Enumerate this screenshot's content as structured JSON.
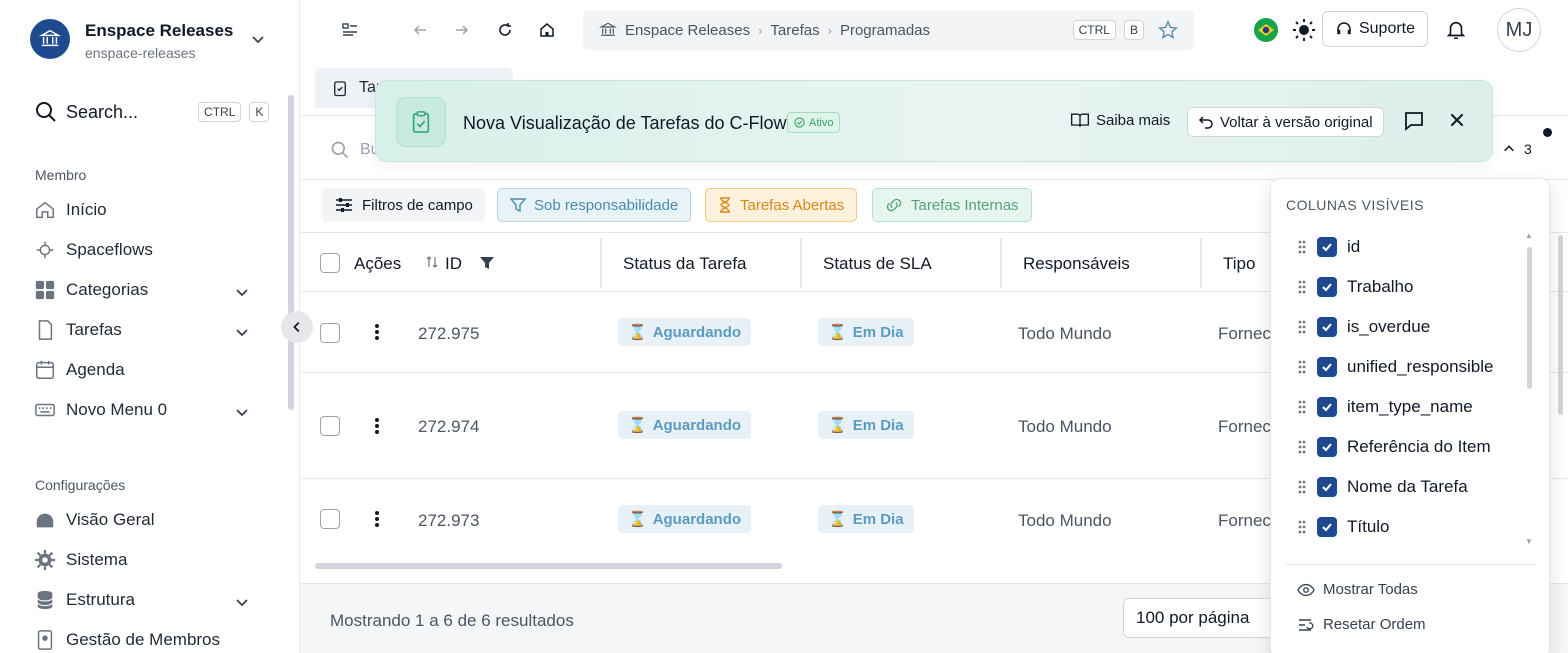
{
  "org": {
    "name": "Enspace Releases",
    "slug": "enspace-releases"
  },
  "search": {
    "label": "Search...",
    "kbd1": "CTRL",
    "kbd2": "K"
  },
  "sections": {
    "member": "Membro",
    "config": "Configurações"
  },
  "nav": {
    "member": [
      {
        "label": "Início",
        "icon": "home-icon"
      },
      {
        "label": "Spaceflows",
        "icon": "flow-icon"
      },
      {
        "label": "Categorias",
        "icon": "grid-icon",
        "expandable": true
      },
      {
        "label": "Tarefas",
        "icon": "document-icon",
        "expandable": true
      },
      {
        "label": "Agenda",
        "icon": "calendar-icon"
      },
      {
        "label": "Novo Menu 0",
        "icon": "keyboard-icon",
        "expandable": true
      }
    ],
    "config": [
      {
        "label": "Visão Geral",
        "icon": "dashboard-icon"
      },
      {
        "label": "Sistema",
        "icon": "gear-icon"
      },
      {
        "label": "Estrutura",
        "icon": "database-icon",
        "expandable": true
      },
      {
        "label": "Gestão de Membros",
        "icon": "id-badge-icon"
      }
    ]
  },
  "breadcrumb": {
    "items": [
      "Enspace Releases",
      "Tarefas",
      "Programadas"
    ],
    "kbd1": "CTRL",
    "kbd2": "B"
  },
  "topbar": {
    "support": "Suporte",
    "avatar": "MJ"
  },
  "tab": {
    "label": "Tar"
  },
  "main_search": {
    "placeholder": "Bu"
  },
  "banner": {
    "title": "Nova Visualização de Tarefas do C-Flow",
    "badge": "Ativo",
    "learn_more": "Saiba mais",
    "revert": "Voltar à versão original"
  },
  "counter": "3",
  "filters": {
    "fields": "Filtros de campo",
    "responsibility": "Sob responsabilidade",
    "open": "Tarefas Abertas",
    "internal": "Tarefas Internas"
  },
  "table": {
    "headers": {
      "actions": "Ações",
      "id": "ID",
      "task_status": "Status da Tarefa",
      "sla_status": "Status de SLA",
      "responsible": "Responsáveis",
      "type": "Tipo"
    },
    "rows": [
      {
        "id": "272.975",
        "status": "Aguardando",
        "sla": "Em Dia",
        "responsible": "Todo Mundo",
        "type": "Fornec"
      },
      {
        "id": "272.974",
        "status": "Aguardando",
        "sla": "Em Dia",
        "responsible": "Todo Mundo",
        "type": "Fornec"
      },
      {
        "id": "272.973",
        "status": "Aguardando",
        "sla": "Em Dia",
        "responsible": "Todo Mundo",
        "type": "Fornec"
      }
    ]
  },
  "footer": {
    "summary": "Mostrando 1 a 6 de 6 resultados",
    "per_page": "100 por página"
  },
  "columns_panel": {
    "title": "COLUNAS VISÍVEIS",
    "columns": [
      "id",
      "Trabalho",
      "is_overdue",
      "unified_responsible",
      "item_type_name",
      "Referência do Item",
      "Nome da Tarefa",
      "Título"
    ],
    "show_all": "Mostrar Todas",
    "reset_order": "Resetar Ordem"
  },
  "colors": {
    "brand": "#1e4b8f",
    "status_blue": "#5a9bc0",
    "open_orange": "#d98916",
    "internal_green": "#54a37e"
  }
}
